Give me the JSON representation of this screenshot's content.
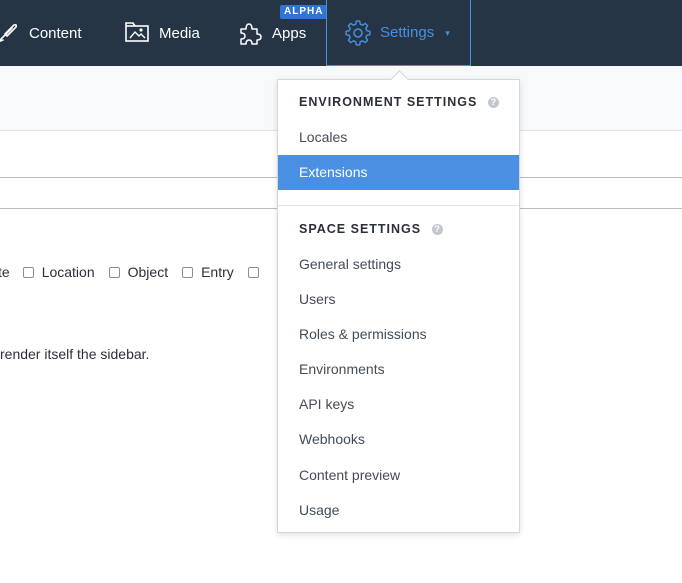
{
  "topnav": {
    "content_label": "Content",
    "media_label": "Media",
    "apps_label": "Apps",
    "apps_badge": "ALPHA",
    "settings_label": "Settings",
    "settings_caret": "▾",
    "icons": {
      "content": "feather-pen-icon",
      "media": "image-folder-icon",
      "apps": "puzzle-piece-icon",
      "settings": "gear-icon"
    }
  },
  "background": {
    "checkbox_fragment": "te",
    "checkboxes": [
      "Location",
      "Object",
      "Entry"
    ],
    "help_text": "render itself the sidebar."
  },
  "menu": {
    "environment_header": "ENVIRONMENT SETTINGS",
    "environment_help": "?",
    "environment_items": [
      "Locales",
      "Extensions"
    ],
    "space_header": "SPACE SETTINGS",
    "space_help": "?",
    "space_items": [
      "General settings",
      "Users",
      "Roles & permissions",
      "Environments",
      "API keys",
      "Webhooks",
      "Content preview",
      "Usage"
    ]
  },
  "colors": {
    "nav_bg": "#253545",
    "accent": "#4a90e2",
    "active_item_bg": "#4a8fe2",
    "badge_bg": "#2e75d4"
  }
}
